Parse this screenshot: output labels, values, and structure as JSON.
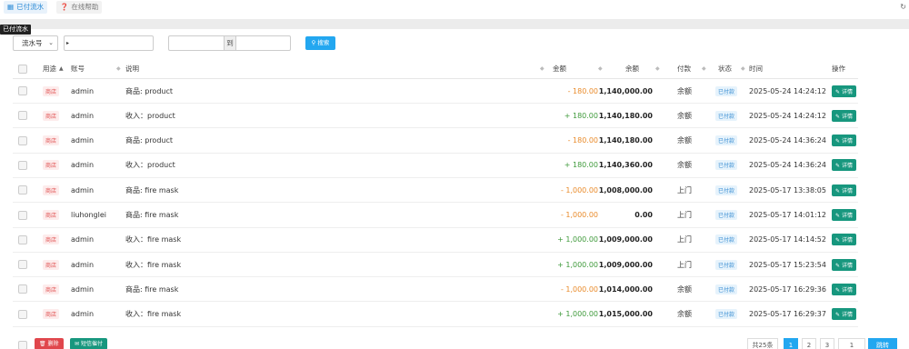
{
  "tabs": [
    {
      "label": "已付流水",
      "icon": "calendar-icon"
    },
    {
      "label": "在线帮助",
      "icon": "question-circle-icon"
    }
  ],
  "tooltip": "已付流水",
  "filters": {
    "select_value": "流水号",
    "range_sep": "到",
    "search_label": "搜索"
  },
  "columns": [
    "用途",
    "账号",
    "说明",
    "金额",
    "余额",
    "付款",
    "状态",
    "时间",
    "操作"
  ],
  "rows": [
    {
      "purpose": "商店",
      "account": "admin",
      "desc": "商品: product",
      "amount": "- 180.00",
      "balance": "1,140,000.00",
      "pay": "余额",
      "status": "已付款",
      "time": "2025-05-24 14:24:12",
      "action": "详情"
    },
    {
      "purpose": "商店",
      "account": "admin",
      "desc": "收入：product",
      "amount": "+ 180.00",
      "balance": "1,140,180.00",
      "pay": "余额",
      "status": "已付款",
      "time": "2025-05-24 14:24:12",
      "action": "详情"
    },
    {
      "purpose": "商店",
      "account": "admin",
      "desc": "商品: product",
      "amount": "- 180.00",
      "balance": "1,140,180.00",
      "pay": "余额",
      "status": "已付款",
      "time": "2025-05-24 14:36:24",
      "action": "详情"
    },
    {
      "purpose": "商店",
      "account": "admin",
      "desc": "收入：product",
      "amount": "+ 180.00",
      "balance": "1,140,360.00",
      "pay": "余额",
      "status": "已付款",
      "time": "2025-05-24 14:36:24",
      "action": "详情"
    },
    {
      "purpose": "商店",
      "account": "admin",
      "desc": "商品: fire mask",
      "amount": "- 1,000.00",
      "balance": "1,008,000.00",
      "pay": "上门",
      "status": "已付款",
      "time": "2025-05-17 13:38:05",
      "action": "详情"
    },
    {
      "purpose": "商店",
      "account": "liuhonglei",
      "desc": "商品: fire mask",
      "amount": "- 1,000.00",
      "balance": "0.00",
      "pay": "上门",
      "status": "已付款",
      "time": "2025-05-17 14:01:12",
      "action": "详情"
    },
    {
      "purpose": "商店",
      "account": "admin",
      "desc": "收入：fire mask",
      "amount": "+ 1,000.00",
      "balance": "1,009,000.00",
      "pay": "上门",
      "status": "已付款",
      "time": "2025-05-17 14:14:52",
      "action": "详情"
    },
    {
      "purpose": "商店",
      "account": "admin",
      "desc": "收入：fire mask",
      "amount": "+ 1,000.00",
      "balance": "1,009,000.00",
      "pay": "上门",
      "status": "已付款",
      "time": "2025-05-17 15:23:54",
      "action": "详情"
    },
    {
      "purpose": "商店",
      "account": "admin",
      "desc": "商品: fire mask",
      "amount": "- 1,000.00",
      "balance": "1,014,000.00",
      "pay": "余额",
      "status": "已付款",
      "time": "2025-05-17 16:29:36",
      "action": "详情"
    },
    {
      "purpose": "商店",
      "account": "admin",
      "desc": "收入：fire mask",
      "amount": "+ 1,000.00",
      "balance": "1,015,000.00",
      "pay": "余额",
      "status": "已付款",
      "time": "2025-05-17 16:29:37",
      "action": "详情"
    }
  ],
  "footer": {
    "delete_label": "删除",
    "sms_label": "短信催付",
    "total": "共25条",
    "pages": [
      "1",
      "2",
      "3"
    ],
    "page_input": "1",
    "go_label": "跳转"
  },
  "colors": {
    "accent": "#23a7f0",
    "detail": "#17977e",
    "negative": "#e98b2b",
    "positive": "#3f9a3b",
    "danger": "#e0464c"
  }
}
